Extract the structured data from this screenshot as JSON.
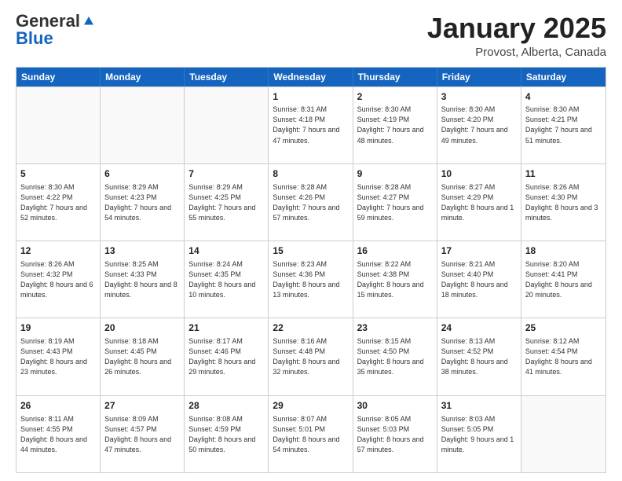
{
  "logo": {
    "general": "General",
    "blue": "Blue"
  },
  "header": {
    "title": "January 2025",
    "location": "Provost, Alberta, Canada"
  },
  "days_of_week": [
    "Sunday",
    "Monday",
    "Tuesday",
    "Wednesday",
    "Thursday",
    "Friday",
    "Saturday"
  ],
  "weeks": [
    [
      {
        "day": "",
        "info": ""
      },
      {
        "day": "",
        "info": ""
      },
      {
        "day": "",
        "info": ""
      },
      {
        "day": "1",
        "info": "Sunrise: 8:31 AM\nSunset: 4:18 PM\nDaylight: 7 hours and 47 minutes."
      },
      {
        "day": "2",
        "info": "Sunrise: 8:30 AM\nSunset: 4:19 PM\nDaylight: 7 hours and 48 minutes."
      },
      {
        "day": "3",
        "info": "Sunrise: 8:30 AM\nSunset: 4:20 PM\nDaylight: 7 hours and 49 minutes."
      },
      {
        "day": "4",
        "info": "Sunrise: 8:30 AM\nSunset: 4:21 PM\nDaylight: 7 hours and 51 minutes."
      }
    ],
    [
      {
        "day": "5",
        "info": "Sunrise: 8:30 AM\nSunset: 4:22 PM\nDaylight: 7 hours and 52 minutes."
      },
      {
        "day": "6",
        "info": "Sunrise: 8:29 AM\nSunset: 4:23 PM\nDaylight: 7 hours and 54 minutes."
      },
      {
        "day": "7",
        "info": "Sunrise: 8:29 AM\nSunset: 4:25 PM\nDaylight: 7 hours and 55 minutes."
      },
      {
        "day": "8",
        "info": "Sunrise: 8:28 AM\nSunset: 4:26 PM\nDaylight: 7 hours and 57 minutes."
      },
      {
        "day": "9",
        "info": "Sunrise: 8:28 AM\nSunset: 4:27 PM\nDaylight: 7 hours and 59 minutes."
      },
      {
        "day": "10",
        "info": "Sunrise: 8:27 AM\nSunset: 4:29 PM\nDaylight: 8 hours and 1 minute."
      },
      {
        "day": "11",
        "info": "Sunrise: 8:26 AM\nSunset: 4:30 PM\nDaylight: 8 hours and 3 minutes."
      }
    ],
    [
      {
        "day": "12",
        "info": "Sunrise: 8:26 AM\nSunset: 4:32 PM\nDaylight: 8 hours and 6 minutes."
      },
      {
        "day": "13",
        "info": "Sunrise: 8:25 AM\nSunset: 4:33 PM\nDaylight: 8 hours and 8 minutes."
      },
      {
        "day": "14",
        "info": "Sunrise: 8:24 AM\nSunset: 4:35 PM\nDaylight: 8 hours and 10 minutes."
      },
      {
        "day": "15",
        "info": "Sunrise: 8:23 AM\nSunset: 4:36 PM\nDaylight: 8 hours and 13 minutes."
      },
      {
        "day": "16",
        "info": "Sunrise: 8:22 AM\nSunset: 4:38 PM\nDaylight: 8 hours and 15 minutes."
      },
      {
        "day": "17",
        "info": "Sunrise: 8:21 AM\nSunset: 4:40 PM\nDaylight: 8 hours and 18 minutes."
      },
      {
        "day": "18",
        "info": "Sunrise: 8:20 AM\nSunset: 4:41 PM\nDaylight: 8 hours and 20 minutes."
      }
    ],
    [
      {
        "day": "19",
        "info": "Sunrise: 8:19 AM\nSunset: 4:43 PM\nDaylight: 8 hours and 23 minutes."
      },
      {
        "day": "20",
        "info": "Sunrise: 8:18 AM\nSunset: 4:45 PM\nDaylight: 8 hours and 26 minutes."
      },
      {
        "day": "21",
        "info": "Sunrise: 8:17 AM\nSunset: 4:46 PM\nDaylight: 8 hours and 29 minutes."
      },
      {
        "day": "22",
        "info": "Sunrise: 8:16 AM\nSunset: 4:48 PM\nDaylight: 8 hours and 32 minutes."
      },
      {
        "day": "23",
        "info": "Sunrise: 8:15 AM\nSunset: 4:50 PM\nDaylight: 8 hours and 35 minutes."
      },
      {
        "day": "24",
        "info": "Sunrise: 8:13 AM\nSunset: 4:52 PM\nDaylight: 8 hours and 38 minutes."
      },
      {
        "day": "25",
        "info": "Sunrise: 8:12 AM\nSunset: 4:54 PM\nDaylight: 8 hours and 41 minutes."
      }
    ],
    [
      {
        "day": "26",
        "info": "Sunrise: 8:11 AM\nSunset: 4:55 PM\nDaylight: 8 hours and 44 minutes."
      },
      {
        "day": "27",
        "info": "Sunrise: 8:09 AM\nSunset: 4:57 PM\nDaylight: 8 hours and 47 minutes."
      },
      {
        "day": "28",
        "info": "Sunrise: 8:08 AM\nSunset: 4:59 PM\nDaylight: 8 hours and 50 minutes."
      },
      {
        "day": "29",
        "info": "Sunrise: 8:07 AM\nSunset: 5:01 PM\nDaylight: 8 hours and 54 minutes."
      },
      {
        "day": "30",
        "info": "Sunrise: 8:05 AM\nSunset: 5:03 PM\nDaylight: 8 hours and 57 minutes."
      },
      {
        "day": "31",
        "info": "Sunrise: 8:03 AM\nSunset: 5:05 PM\nDaylight: 9 hours and 1 minute."
      },
      {
        "day": "",
        "info": ""
      }
    ]
  ]
}
